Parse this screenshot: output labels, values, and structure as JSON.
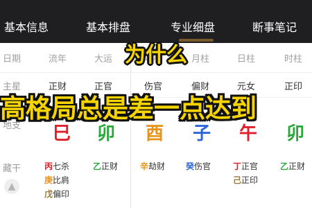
{
  "tabs": [
    {
      "label": "基本信息"
    },
    {
      "label": "基本排盘"
    },
    {
      "label": "专业细盘",
      "active": true
    },
    {
      "label": "断事笔记"
    }
  ],
  "columns": [
    "日期",
    "流年",
    "大运",
    "年柱",
    "月柱",
    "日柱",
    "时柱"
  ],
  "rows": {
    "main_star": {
      "label": "主星",
      "values": [
        "正财",
        "正官",
        "伤官",
        "偏财",
        "元女",
        "正印"
      ]
    },
    "branch": {
      "label": "地支",
      "values": [
        {
          "char": "巳",
          "color": "#e0202a"
        },
        {
          "char": "卯",
          "color": "#2aa838"
        },
        {
          "char": "酉",
          "color": "#e8941a"
        },
        {
          "char": "子",
          "color": "#2a66d8"
        },
        {
          "char": "午",
          "color": "#e0202a"
        },
        {
          "char": "卯",
          "color": "#2aa838"
        }
      ]
    },
    "hidden": {
      "label": "藏干",
      "values": [
        [
          {
            "stem": "丙",
            "god": "七杀",
            "color": "#e0202a"
          },
          {
            "stem": "庚",
            "god": "比肩",
            "color": "#e8941a"
          },
          {
            "stem": "戊",
            "god": "偏印",
            "color": "#9a7a3a"
          }
        ],
        [
          {
            "stem": "乙",
            "god": "正财",
            "color": "#2aa838"
          }
        ],
        [
          {
            "stem": "辛",
            "god": "劫财",
            "color": "#e8941a"
          }
        ],
        [
          {
            "stem": "癸",
            "god": "伤官",
            "color": "#2a66d8"
          }
        ],
        [
          {
            "stem": "丁",
            "god": "正官",
            "color": "#e0202a"
          },
          {
            "stem": "己",
            "god": "正印",
            "color": "#9a7a3a"
          }
        ],
        [
          {
            "stem": "乙",
            "god": "正财",
            "color": "#2aa838"
          }
        ]
      ]
    }
  },
  "captions": {
    "line1": "为什么",
    "line2": "高格局总是差一点达到"
  },
  "icons": {
    "fab": "image-icon"
  }
}
